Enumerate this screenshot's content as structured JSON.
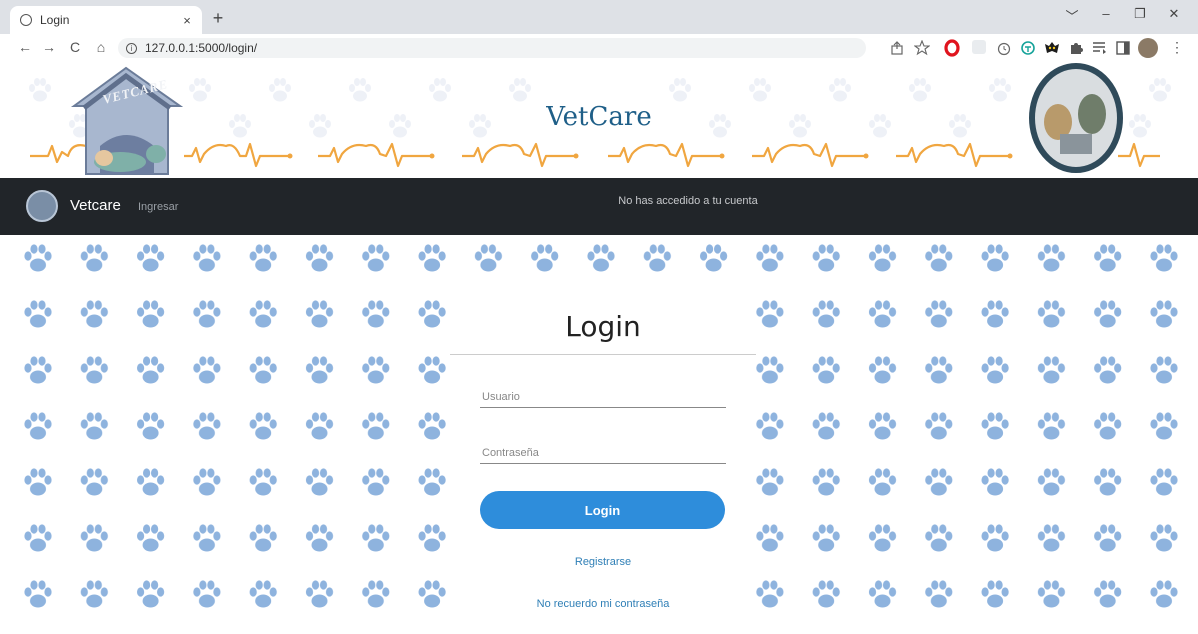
{
  "browser": {
    "tab_title": "Login",
    "tab_close": "×",
    "new_tab": "+",
    "url": "127.0.0.1:5000/login/",
    "back": "←",
    "forward": "→",
    "reload": "C",
    "home": "⌂",
    "win_dropdown": "﹀",
    "win_minimize": "–",
    "win_restore": "❐",
    "win_close": "✕"
  },
  "banner": {
    "title": "VetCare",
    "logo_text": "VETCARE"
  },
  "navbar": {
    "brand": "Vetcare",
    "link": "Ingresar",
    "status": "No has accedido a tu cuenta"
  },
  "login": {
    "title": "Login",
    "username_placeholder": "Usuario",
    "password_placeholder": "Contraseña",
    "button": "Login",
    "register_link": "Registrarse",
    "forgot_link": "No recuerdo mi contraseña"
  },
  "colors": {
    "paw": "#8eb3de",
    "nav_bg": "#212529",
    "button": "#2e8ddb",
    "title": "#1f5f88",
    "heartbeat": "#f0a640"
  }
}
